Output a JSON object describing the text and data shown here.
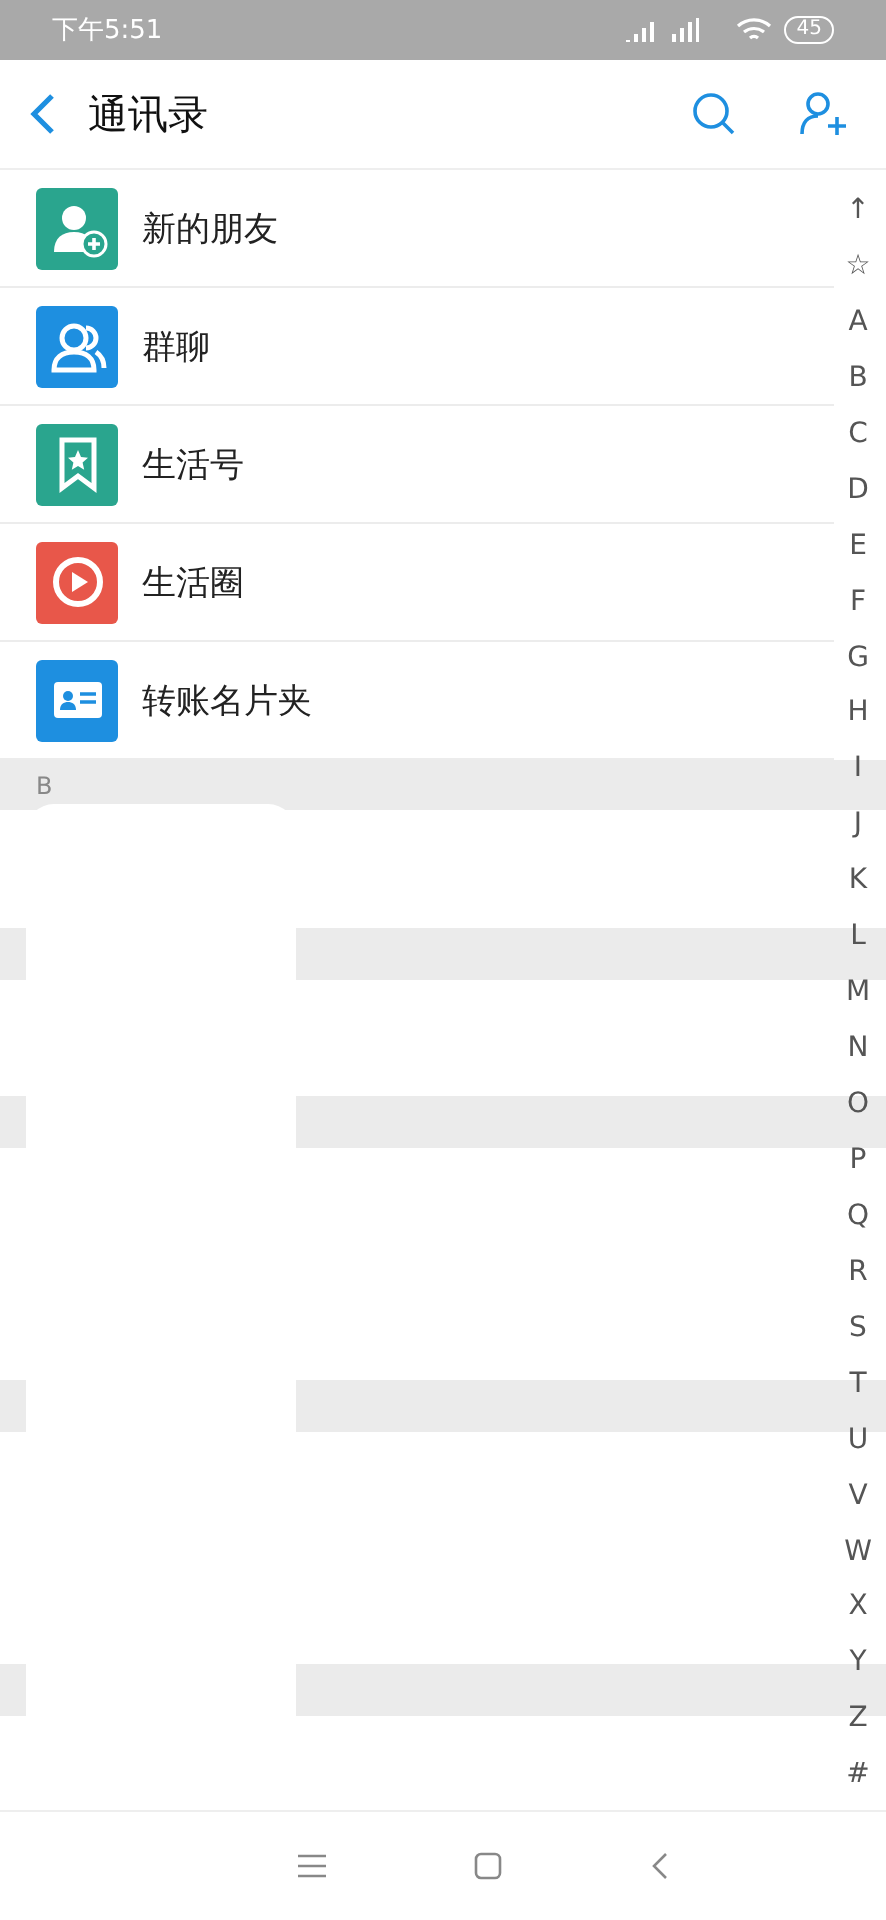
{
  "status_bar": {
    "time": "下午5:51",
    "battery": "45"
  },
  "header": {
    "title": "通讯录"
  },
  "entries": [
    {
      "label": "新的朋友",
      "kind": "new-friend",
      "color": "#2aa58e"
    },
    {
      "label": "群聊",
      "kind": "group",
      "color": "#1e8fe0"
    },
    {
      "label": "生活号",
      "kind": "bookmark",
      "color": "#2aa58e"
    },
    {
      "label": "生活圈",
      "kind": "circle",
      "color": "#e8574a"
    },
    {
      "label": "转账名片夹",
      "kind": "card",
      "color": "#1e8fe0"
    }
  ],
  "section": {
    "label": "B"
  },
  "index": [
    "↑",
    "☆",
    "A",
    "B",
    "C",
    "D",
    "E",
    "F",
    "G",
    "H",
    "I",
    "J",
    "K",
    "L",
    "M",
    "N",
    "O",
    "P",
    "Q",
    "R",
    "S",
    "T",
    "U",
    "V",
    "W",
    "X",
    "Y",
    "Z",
    "#"
  ]
}
